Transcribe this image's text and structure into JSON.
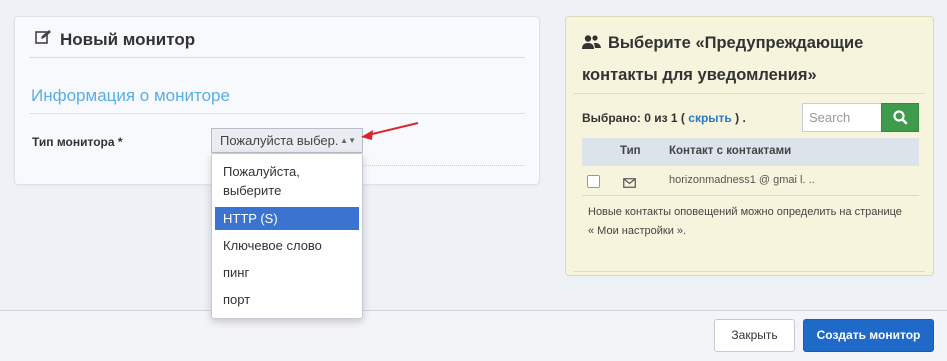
{
  "new_monitor": {
    "title": "Новый монитор",
    "section_title": "Информация о мониторе",
    "monitor_type_label": "Тип монитора *",
    "monitor_type_value": "Пожалуйста выбер.",
    "options": [
      "Пожалуйста, выберите",
      "HTTP (S)",
      "Ключевое слово",
      "пинг",
      "порт"
    ],
    "selected_option": "HTTP (S)"
  },
  "alert_contacts": {
    "title": "Выберите «Предупреждающие контакты для уведомления»",
    "selected_prefix": "Выбрано: 0 из 1 (",
    "hide_link": "скрыть",
    "selected_suffix": ") .",
    "search_placeholder": "Search",
    "columns": [
      "Тип",
      "Контакт с контактами"
    ],
    "rows": [
      {
        "contact": "horizonmadness1 @ gmai l. ..",
        "type_icon": "envelope-icon"
      }
    ],
    "note": "Новые контакты оповещений можно определить на странице « Мои настройки »."
  },
  "footer": {
    "close_label": "Закрыть",
    "create_label": "Создать монитор"
  },
  "colors": {
    "accent_blue": "#1f6ac9",
    "section_title": "#5aaee2",
    "selected_option_bg": "#3a74d0",
    "search_button": "#3e9a4d",
    "contacts_panel_bg": "#f6f4dc",
    "annotation_arrow": "#d9262b"
  }
}
